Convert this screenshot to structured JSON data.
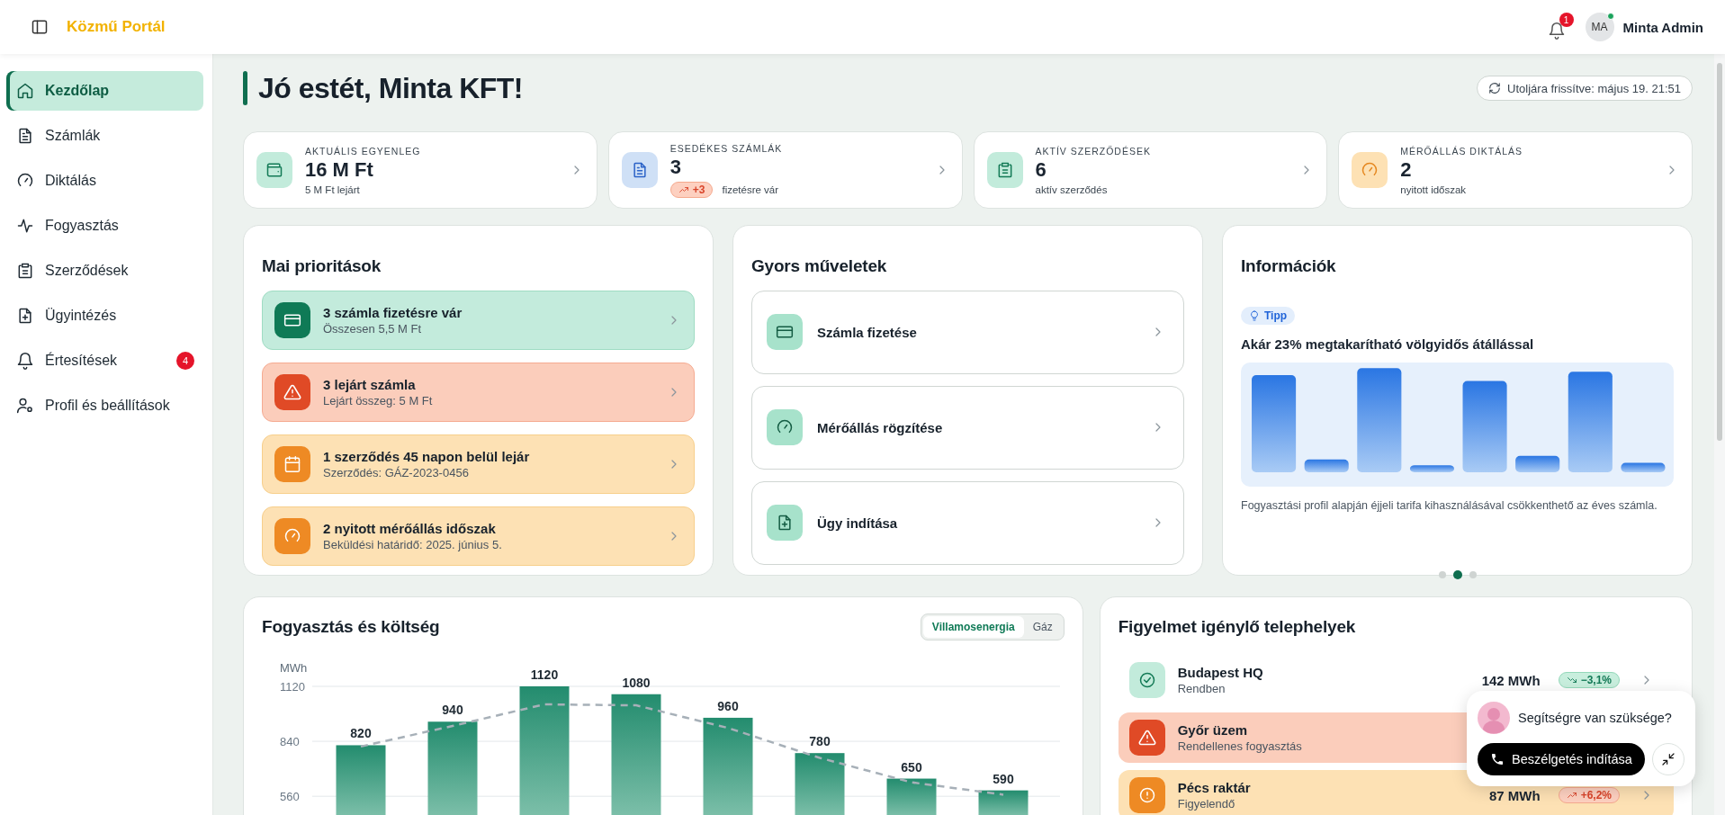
{
  "header": {
    "logo": "Közmű Portál",
    "notification_count": "1",
    "user": {
      "initials": "MA",
      "name": "Minta Admin",
      "online": true
    }
  },
  "sidebar": {
    "items": [
      {
        "label": "Kezdőlap",
        "selected": true
      },
      {
        "label": "Számlák",
        "selected": false
      },
      {
        "label": "Diktálás",
        "selected": false
      },
      {
        "label": "Fogyasztás",
        "selected": false
      },
      {
        "label": "Szerződések",
        "selected": false
      },
      {
        "label": "Ügyintézés",
        "selected": false
      },
      {
        "label": "Értesítések",
        "selected": false,
        "badge": "4"
      },
      {
        "label": "Profil és beállítások",
        "selected": false
      }
    ]
  },
  "greeting": {
    "title": "Jó estét, Minta KFT!",
    "refreshed": "Utoljára frissítve: május 19. 21:51"
  },
  "stats": [
    {
      "label": "AKTUÁLIS EGYENLEG",
      "value": "16 M Ft",
      "sub": "5 M Ft lejárt"
    },
    {
      "label": "ESEDÉKES SZÁMLÁK",
      "value": "3",
      "badge": "+3",
      "rising": true,
      "sub": "fizetésre vár"
    },
    {
      "label": "AKTÍV SZERZŐDÉSEK",
      "value": "6",
      "sub": "aktív szerződés"
    },
    {
      "label": "MÉRŐÁLLÁS DIKTÁLÁS",
      "value": "2",
      "sub": "nyitott időszak"
    }
  ],
  "priorities": {
    "title": "Mai prioritások",
    "items": [
      {
        "kind": "success",
        "title": "3 számla fizetésre vár",
        "sub": "Összesen 5,5 M Ft"
      },
      {
        "kind": "danger",
        "title": "3 lejárt számla",
        "sub": "Lejárt összeg: 5 M Ft"
      },
      {
        "kind": "warning",
        "title": "1 szerződés 45 napon belül lejár",
        "sub": "Szerződés: GÁZ-2023-0456"
      },
      {
        "kind": "warning",
        "title": "2 nyitott mérőállás időszak",
        "sub": "Beküldési határidő: 2025. június 5."
      }
    ]
  },
  "quick_actions": {
    "title": "Gyors műveletek",
    "items": [
      "Számla fizetése",
      "Mérőállás rögzítése",
      "Ügy indítása"
    ]
  },
  "info": {
    "title": "Információk",
    "tag": "Tipp",
    "heading": "Akár 23% megtakarítható völgyidős átállással",
    "caption": "Fogyasztási profil alapján éjjeli tarifa kihasználásával csökkenthető az éves számla.",
    "dots": [
      {
        "selected": false
      },
      {
        "selected": true
      },
      {
        "selected": false
      }
    ]
  },
  "consumption": {
    "title": "Fogyasztás és költség",
    "toggle": [
      {
        "label": "Villamosenergia",
        "selected": true
      },
      {
        "label": "Gáz",
        "selected": false
      }
    ],
    "chart_data": {
      "type": "bar",
      "ylabel": "MWh",
      "ylim": [
        460,
        1120
      ],
      "grid": true,
      "yticks": [
        560,
        840,
        1120
      ],
      "data_labels": true,
      "values": [
        820,
        940,
        1120,
        1080,
        960,
        780,
        650,
        590
      ]
    }
  },
  "sites": {
    "title": "Figyelmet igénylő telephelyek",
    "rows": [
      {
        "kind": "ok",
        "name": "Budapest HQ",
        "status": "Rendben",
        "value": "142 MWh",
        "change": "−3,1%",
        "rising": false
      },
      {
        "kind": "danger",
        "name": "Győr üzem",
        "status": "Rendellenes fogyasztás"
      },
      {
        "kind": "warning",
        "name": "Pécs raktár",
        "status": "Figyelendő",
        "value": "87 MWh",
        "change": "+6,2%",
        "rising": true
      }
    ]
  },
  "chat": {
    "question": "Segítségre van szüksége?",
    "button": "Beszélgetés indítása"
  }
}
